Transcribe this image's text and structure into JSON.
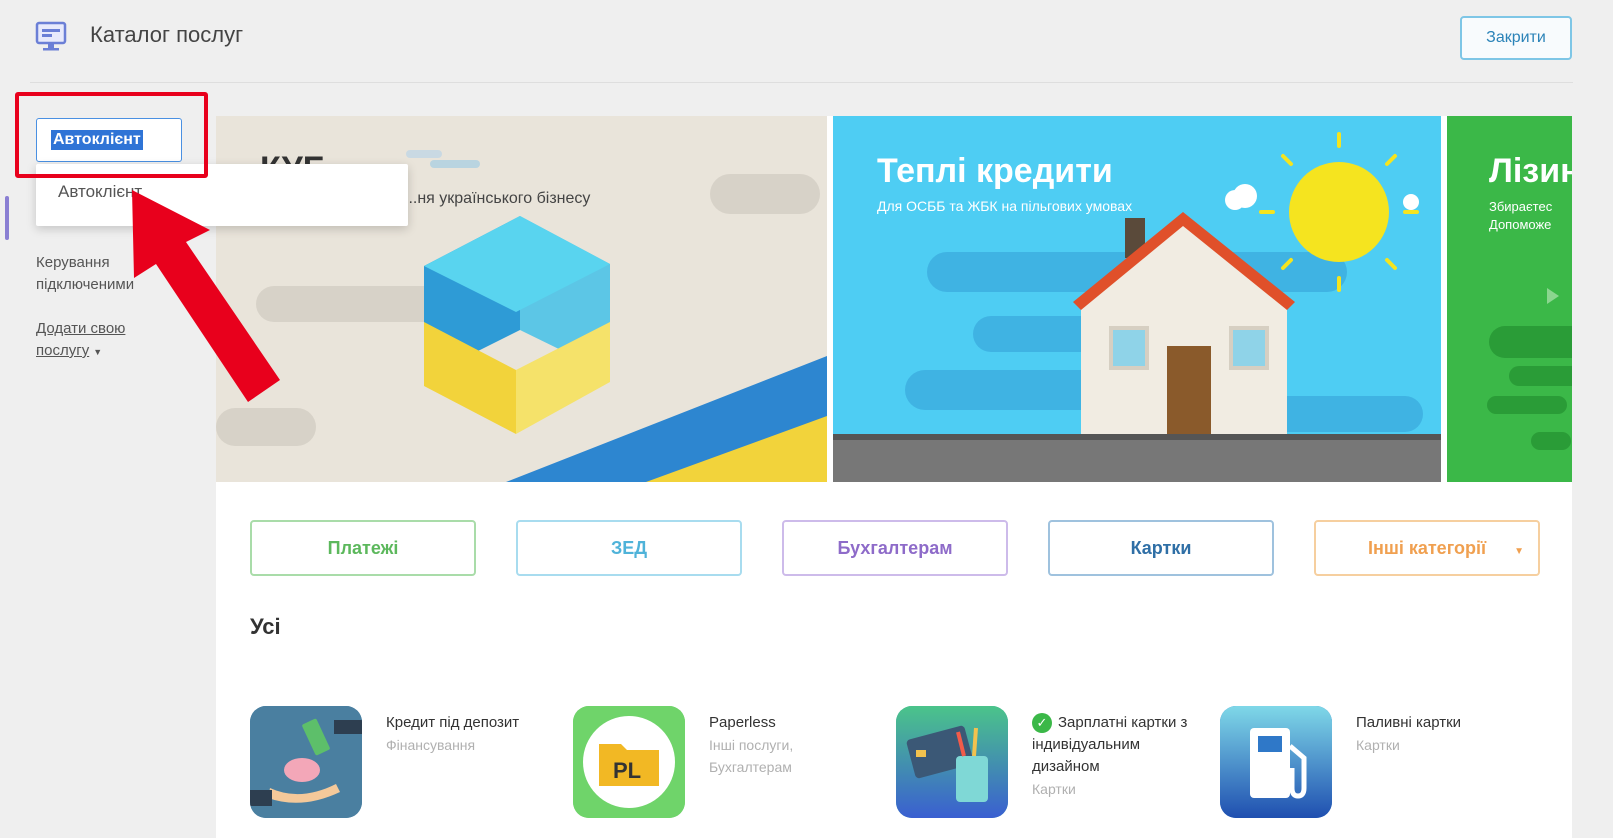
{
  "header": {
    "title": "Каталог послуг",
    "close_label": "Закрити"
  },
  "sidebar": {
    "search_value": "Автоклієнт",
    "suggestion": "Автоклієнт",
    "manage_label": "Керування підключеними",
    "add_label": "Додати свою послугу"
  },
  "banners": {
    "kyb": {
      "title": "КУБ",
      "subtitle": "...ня українського бізнесу"
    },
    "credit": {
      "title": "Теплі кредити",
      "subtitle": "Для ОСББ та ЖБК на пільгових умовах"
    },
    "lease": {
      "title": "Лізин",
      "subtitle_1": "Збираєтес",
      "subtitle_2": "Допоможе"
    }
  },
  "categories": [
    {
      "label": "Платежі",
      "color": "#5cb85c"
    },
    {
      "label": "ЗЕД",
      "color": "#4fb3d9"
    },
    {
      "label": "Бухгалтерам",
      "color": "#8e6bc9"
    },
    {
      "label": "Картки",
      "color": "#2f6fa6"
    },
    {
      "label": "Інші категорії",
      "color": "#f0a050"
    }
  ],
  "section_title": "Усі",
  "services": [
    {
      "name": "Кредит під депозит",
      "category": "Фінансування"
    },
    {
      "name": "Paperless",
      "category": "Інші послуги, Бухгалтерам",
      "tile_text": "PL"
    },
    {
      "name": "Зарплатні картки з індивідуальним дизайном",
      "category": "Картки"
    },
    {
      "name": "Паливні картки",
      "category": "Картки"
    }
  ],
  "colors": {
    "accent_blue": "#4a90e2",
    "highlight_red": "#e8001c",
    "credit_bg": "#4ecdf3",
    "lease_bg": "#3bb848"
  },
  "icons": [
    "monitor-icon",
    "chevron-down-icon",
    "check-icon",
    "piggy-bank-icon",
    "folder-icon",
    "card-icon",
    "fuel-pump-icon"
  ]
}
